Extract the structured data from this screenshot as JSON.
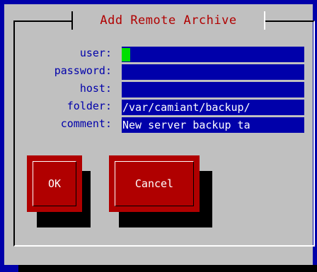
{
  "dialog": {
    "title": "Add Remote Archive"
  },
  "form": {
    "user_label": "user:",
    "user_value": "",
    "password_label": "password:",
    "password_value": "",
    "host_label": "host:",
    "host_value": "",
    "folder_label": "folder:",
    "folder_value": "/var/camiant/backup/",
    "comment_label": "comment:",
    "comment_value": "New server backup ta"
  },
  "buttons": {
    "ok_label": "OK",
    "cancel_label": "Cancel"
  },
  "colors": {
    "screen_background": "#0000aa",
    "dialog_background": "#c0c0c0",
    "title_text": "#b00000",
    "label_text": "#0000aa",
    "field_background": "#0000aa",
    "cursor": "#00e000",
    "button_background": "#b00000",
    "button_text": "#ffffff"
  }
}
